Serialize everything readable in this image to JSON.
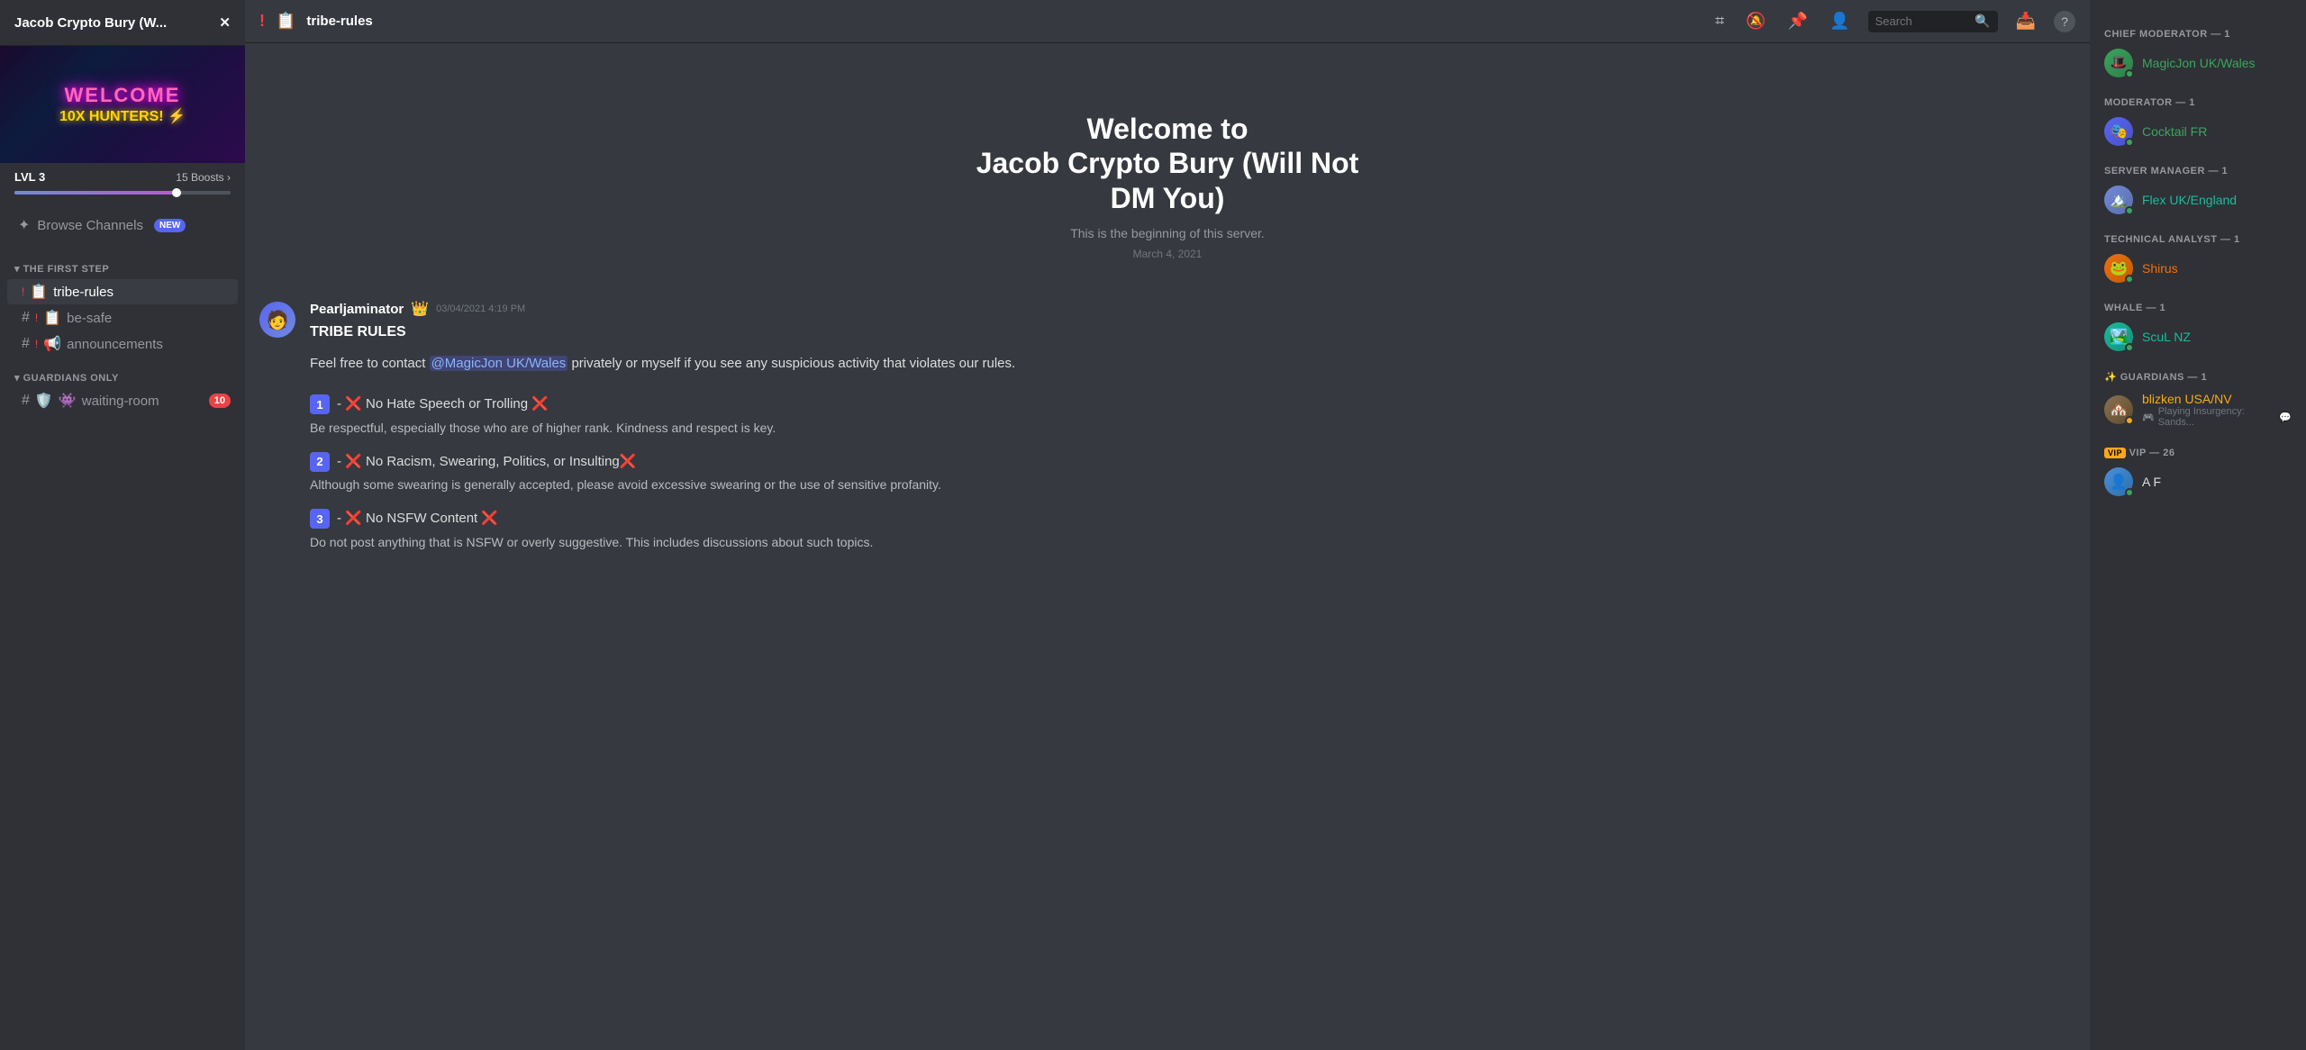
{
  "app": {
    "title": "Jacob Crypto Bury (W..."
  },
  "server": {
    "name": "Jacob Crypto Bury (W...",
    "banner": {
      "welcome": "WELCOME",
      "subtitle": "10X HUNTERS!",
      "lightning": "⚡"
    },
    "level": {
      "label": "LVL 3",
      "boosts": "15 Boosts",
      "boost_progress": 75
    }
  },
  "sidebar": {
    "browse_channels": "Browse Channels",
    "new_badge": "NEW",
    "categories": [
      {
        "name": "THE FIRST STEP",
        "channels": [
          {
            "id": "tribe-rules",
            "type": "text",
            "prefix": "!",
            "name": "tribe-rules",
            "active": true,
            "icon": "📋",
            "action": "add-user"
          },
          {
            "id": "be-safe",
            "type": "text",
            "prefix": "!",
            "name": "be-safe",
            "icon": "📋"
          },
          {
            "id": "announcements",
            "type": "text",
            "prefix": "!",
            "name": "announcements",
            "icon": "📢",
            "action": "add-user"
          }
        ]
      },
      {
        "name": "GUARDIANS ONLY",
        "channels": [
          {
            "id": "waiting-room",
            "type": "text",
            "name": "waiting-room",
            "icon": "🛡️",
            "badge": 10
          }
        ]
      }
    ]
  },
  "header": {
    "channel_icon": "!",
    "channel_name": "tribe-rules",
    "channel_prefix": "📋",
    "actions": {
      "hash": "#",
      "bell": "🔔",
      "pin": "📌",
      "members": "👤",
      "search_placeholder": "Search",
      "inbox": "📥",
      "help": "?"
    }
  },
  "chat": {
    "welcome_title": "Welcome to\nJacob Crypto Bury (Will Not\nDM You)",
    "welcome_line1": "Welcome to",
    "welcome_line2": "Jacob Crypto Bury (Will Not",
    "welcome_line3": "DM You)",
    "welcome_subtitle": "This is the beginning of this server.",
    "welcome_date": "March 4, 2021",
    "message": {
      "author": "Pearljaminator",
      "author_badge": "👑",
      "timestamp": "03/04/2021 4:19 PM",
      "rules_title": "TRIBE RULES",
      "intro_text": "Feel free to contact",
      "mention": "@MagicJon UK/Wales",
      "intro_text2": "privately or myself if you see any suspicious activity that violates our rules.",
      "rules": [
        {
          "num": "1",
          "title": "- ❌ No Hate Speech or Trolling ❌",
          "description": "Be respectful, especially those who are of higher rank. Kindness and respect is key."
        },
        {
          "num": "2",
          "title": "- ❌ No Racism, Swearing, Politics, or Insulting❌",
          "description": "Although some swearing is generally accepted, please avoid excessive swearing or the use of sensitive profanity."
        },
        {
          "num": "3",
          "title": "- ❌ No NSFW Content ❌",
          "description": "Do not post anything that is NSFW or overly suggestive. This includes discussions about such topics."
        }
      ]
    }
  },
  "members": {
    "categories": [
      {
        "role": "CHIEF MODERATOR",
        "count": 1,
        "label": "CHIEF MODERATOR — 1",
        "members": [
          {
            "name": "MagicJon UK/Wales",
            "color": "green",
            "status": "online",
            "avatar_emoji": "🎩"
          }
        ]
      },
      {
        "role": "MODERATOR",
        "count": 1,
        "label": "MODERATOR — 1",
        "members": [
          {
            "name": "Cocktail FR",
            "color": "green",
            "status": "online",
            "avatar_emoji": "🎭"
          }
        ]
      },
      {
        "role": "SERVER MANAGER",
        "count": 1,
        "label": "SERVER MANAGER — 1",
        "members": [
          {
            "name": "Flex UK/England",
            "color": "teal",
            "status": "online",
            "avatar_emoji": "🏔️"
          }
        ]
      },
      {
        "role": "TECHNICAL ANALYST",
        "count": 1,
        "label": "TECHNICAL ANALYST — 1",
        "members": [
          {
            "name": "Shirus",
            "color": "orange",
            "status": "online",
            "avatar_emoji": "🐸"
          }
        ]
      },
      {
        "role": "WHALE",
        "count": 1,
        "label": "WHALE — 1",
        "members": [
          {
            "name": "ScuL NZ",
            "color": "teal",
            "status": "online",
            "avatar_emoji": "🏞️"
          }
        ]
      },
      {
        "role": "GUARDIANS",
        "count": 1,
        "label": "GUARDIANS — 1",
        "members": [
          {
            "name": "blizken USA/NV",
            "color": "yellow",
            "status": "online",
            "avatar_emoji": "🏘️",
            "status_text": "Playing Insurgency: Sands..."
          }
        ]
      },
      {
        "role": "VIP",
        "count": 26,
        "label": "VIP — 26",
        "members": [
          {
            "name": "A F",
            "color": "default",
            "status": "online",
            "avatar_emoji": "👤",
            "vip": true
          }
        ]
      }
    ]
  }
}
